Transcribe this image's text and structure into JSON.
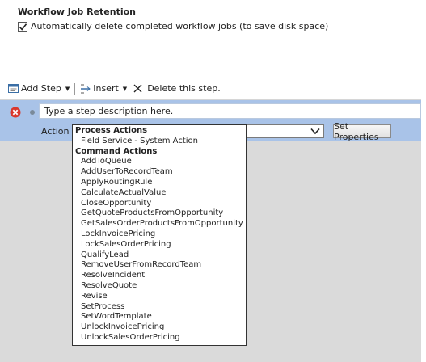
{
  "retention": {
    "title": "Workflow Job Retention",
    "auto_delete_label": "Automatically delete completed workflow jobs (to save disk space)",
    "auto_delete_checked": true
  },
  "toolbar": {
    "add_step_label": "Add Step",
    "insert_label": "Insert",
    "delete_label": "Delete this step.",
    "icons": {
      "add_step": "add-step-icon",
      "insert": "insert-icon",
      "delete": "delete-x-icon",
      "caret": "caret-down-icon"
    }
  },
  "step": {
    "description_placeholder": "Type a step description here.",
    "action_label": "Action",
    "set_properties_label": "Set Properties",
    "icons": {
      "error": "error-icon",
      "bullet": "bullet-icon",
      "dropdown_arrow": "chevron-down-icon"
    }
  },
  "action_dropdown": {
    "items": [
      {
        "label": "Process Actions",
        "type": "group"
      },
      {
        "label": "Field Service - System Action",
        "type": "option"
      },
      {
        "label": "Command Actions",
        "type": "group"
      },
      {
        "label": "AddToQueue",
        "type": "option"
      },
      {
        "label": "AddUserToRecordTeam",
        "type": "option"
      },
      {
        "label": "ApplyRoutingRule",
        "type": "option"
      },
      {
        "label": "CalculateActualValue",
        "type": "option"
      },
      {
        "label": "CloseOpportunity",
        "type": "option"
      },
      {
        "label": "GetQuoteProductsFromOpportunity",
        "type": "option"
      },
      {
        "label": "GetSalesOrderProductsFromOpportunity",
        "type": "option"
      },
      {
        "label": "LockInvoicePricing",
        "type": "option"
      },
      {
        "label": "LockSalesOrderPricing",
        "type": "option"
      },
      {
        "label": "QualifyLead",
        "type": "option"
      },
      {
        "label": "RemoveUserFromRecordTeam",
        "type": "option"
      },
      {
        "label": "ResolveIncident",
        "type": "option"
      },
      {
        "label": "ResolveQuote",
        "type": "option"
      },
      {
        "label": "Revise",
        "type": "option"
      },
      {
        "label": "SetProcess",
        "type": "option"
      },
      {
        "label": "SetWordTemplate",
        "type": "option"
      },
      {
        "label": "UnlockInvoicePricing",
        "type": "option"
      },
      {
        "label": "UnlockSalesOrderPricing",
        "type": "option"
      }
    ]
  },
  "colors": {
    "step_band": "#a9c3e8",
    "work_area": "#dadada",
    "error_red": "#d9372c"
  }
}
